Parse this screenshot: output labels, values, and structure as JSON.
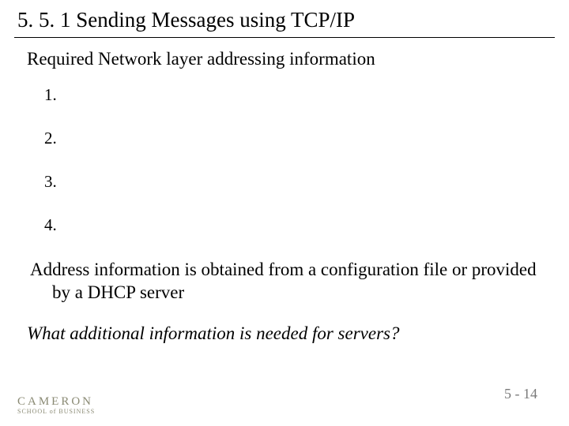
{
  "title": "5. 5. 1  Sending Messages using TCP/IP",
  "subhead": "Required Network layer addressing information",
  "list": {
    "items": [
      "1.",
      "2.",
      "3.",
      "4."
    ]
  },
  "para": "Address information is obtained from a configuration file or provided by a DHCP server",
  "question": "What additional information is needed for servers?",
  "logo": {
    "main": "CAMERON",
    "sub": "SCHOOL of BUSINESS"
  },
  "pagenum": "5 - 14"
}
